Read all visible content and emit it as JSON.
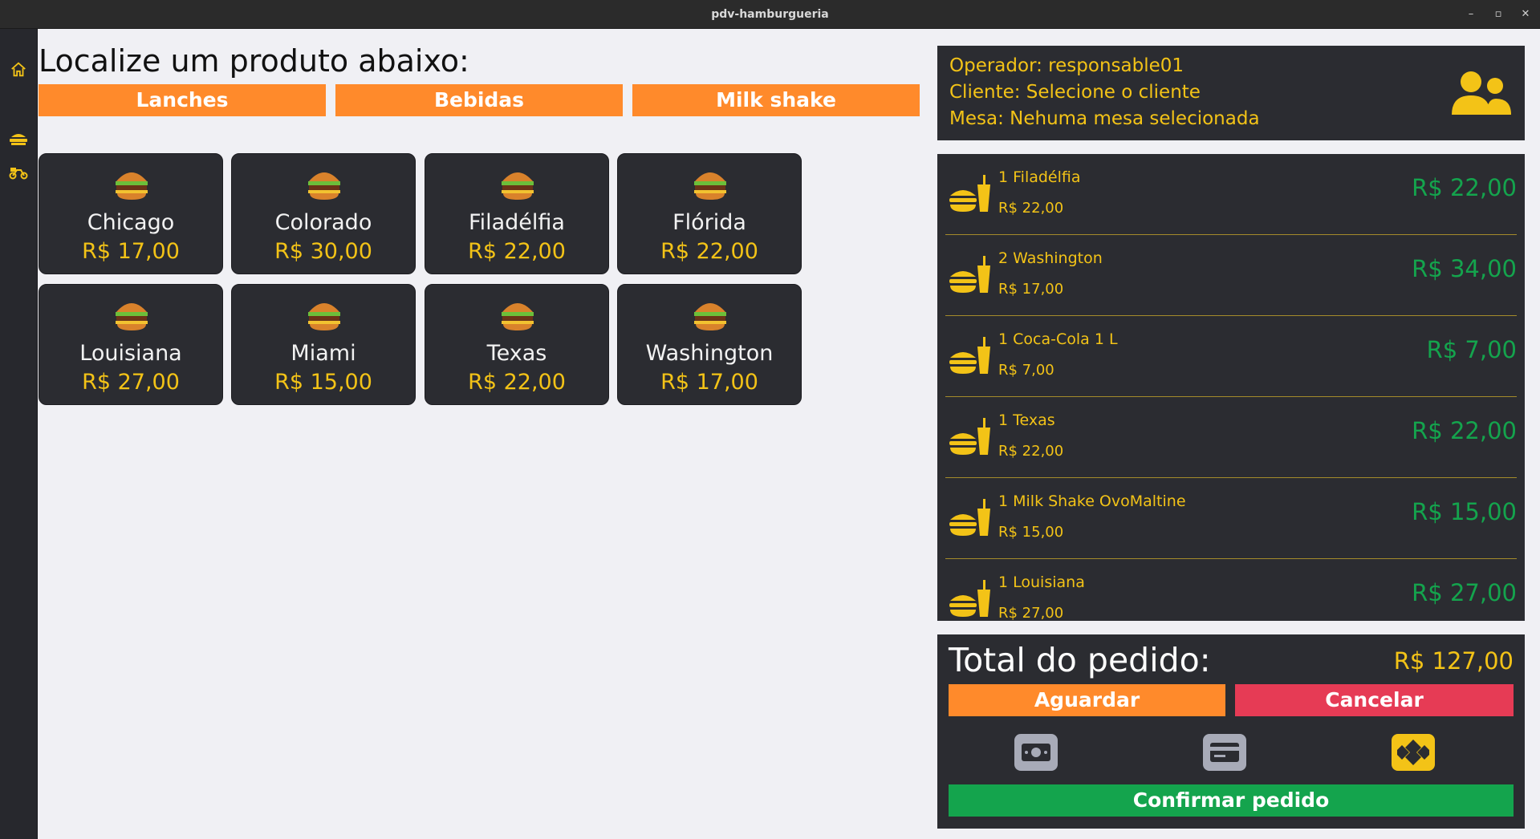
{
  "window": {
    "title": "pdv-hamburgueria",
    "minimize": "–",
    "maximize": "▫",
    "close": "✕"
  },
  "colors": {
    "accent_orange": "#ff8a2b",
    "accent_yellow": "#f3c317",
    "danger": "#e63b55",
    "success": "#14a44d",
    "panel": "#2b2c31"
  },
  "sidebar": {
    "items": [
      {
        "icon": "home-icon"
      },
      {
        "icon": "food-counter-icon"
      },
      {
        "icon": "delivery-scooter-icon"
      }
    ]
  },
  "main": {
    "title": "Localize um produto abaixo:",
    "tabs": [
      {
        "label": "Lanches"
      },
      {
        "label": "Bebidas"
      },
      {
        "label": "Milk shake"
      }
    ],
    "products": [
      {
        "name": "Chicago",
        "price": "R$ 17,00",
        "icon": "burger-icon"
      },
      {
        "name": "Colorado",
        "price": "R$ 30,00",
        "icon": "burger-icon"
      },
      {
        "name": "Filadélfia",
        "price": "R$ 22,00",
        "icon": "burger-icon"
      },
      {
        "name": "Flórida",
        "price": "R$ 22,00",
        "icon": "burger-icon"
      },
      {
        "name": "Louisiana",
        "price": "R$ 27,00",
        "icon": "burger-icon"
      },
      {
        "name": "Miami",
        "price": "R$ 15,00",
        "icon": "burger-icon"
      },
      {
        "name": "Texas",
        "price": "R$ 22,00",
        "icon": "burger-icon"
      },
      {
        "name": "Washington",
        "price": "R$ 17,00",
        "icon": "burger-icon"
      }
    ]
  },
  "info": {
    "operator": "Operador: responsable01",
    "client": "Cliente:  Selecione o cliente",
    "table": "Mesa:  Nehuma mesa selecionada",
    "icon": "users-icon"
  },
  "order": {
    "items": [
      {
        "name": "1 Filadélfia",
        "unit_price": "R$ 22,00",
        "total": "R$ 22,00"
      },
      {
        "name": "2 Washington",
        "unit_price": "R$ 17,00",
        "total": "R$ 34,00"
      },
      {
        "name": "1 Coca-Cola 1 L",
        "unit_price": "R$ 7,00",
        "total": "R$ 7,00"
      },
      {
        "name": "1 Texas",
        "unit_price": "R$ 22,00",
        "total": "R$ 22,00"
      },
      {
        "name": "1 Milk Shake OvoMaltine",
        "unit_price": "R$ 15,00",
        "total": "R$ 15,00"
      },
      {
        "name": "1 Louisiana",
        "unit_price": "R$ 27,00",
        "total": "R$ 27,00"
      }
    ]
  },
  "summary": {
    "total_label": "Total do pedido:",
    "total_value": "R$ 127,00",
    "wait_label": "Aguardar",
    "cancel_label": "Cancelar",
    "confirm_label": "Confirmar pedido",
    "payments": [
      {
        "icon": "cash-icon"
      },
      {
        "icon": "card-icon"
      },
      {
        "icon": "pix-icon",
        "selected": true
      }
    ]
  }
}
